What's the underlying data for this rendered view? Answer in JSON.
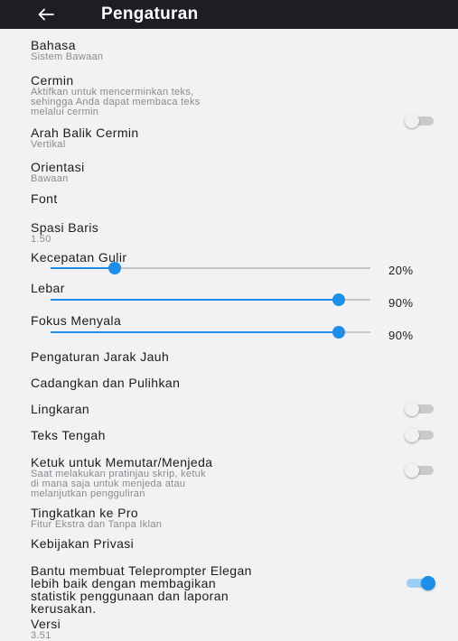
{
  "appbar": {
    "title": "Pengaturan",
    "back_icon": "arrow-left-icon"
  },
  "colors": {
    "appbar_bg": "#1d1d23",
    "accent": "#1e8fe8",
    "background": "#f2f2f4"
  },
  "settings": {
    "language": {
      "title": "Bahasa",
      "value": "Sistem Bawaan"
    },
    "mirror": {
      "title": "Cermin",
      "desc1": "Aktifkan untuk mencerminkan teks,",
      "desc2": "sehingga Anda dapat membaca teks",
      "desc3": "melalui cermin",
      "enabled": false
    },
    "mirror_direction": {
      "title": "Arah Balik Cermin",
      "value": "Vertikal"
    },
    "orientation": {
      "title": "Orientasi",
      "value": "Bawaan"
    },
    "font": {
      "title": "Font"
    },
    "line_spacing": {
      "title": "Spasi Baris",
      "value": "1.50"
    },
    "scroll_speed": {
      "title": "Kecepatan Gulir",
      "percent": 20,
      "label": "20%"
    },
    "width": {
      "title": "Lebar",
      "percent": 90,
      "label": "90%"
    },
    "focus": {
      "title": "Fokus Menyala",
      "percent": 90,
      "label": "90%"
    },
    "remote": {
      "title": "Pengaturan Jarak Jauh"
    },
    "backup": {
      "title": "Cadangkan dan Pulihkan"
    },
    "circle": {
      "title": "Lingkaran",
      "enabled": false
    },
    "center_text": {
      "title": "Teks Tengah",
      "enabled": false
    },
    "tap_to_play": {
      "title": "Ketuk untuk Memutar/Menjeda",
      "desc1": "Saat melakukan pratinjau skrip, ketuk",
      "desc2": "di mana saja untuk menjeda atau",
      "desc3": "melanjutkan pengguliran",
      "enabled": false
    },
    "upgrade": {
      "title": "Tingkatkan ke Pro",
      "desc": "Fitur Ekstra dan Tanpa Iklan"
    },
    "privacy": {
      "title": "Kebijakan Privasi"
    },
    "stats": {
      "line1": "Bantu membuat Teleprompter Elegan",
      "line2": "lebih baik dengan membagikan",
      "line3": "statistik penggunaan dan laporan",
      "line4": "kerusakan.",
      "enabled": true
    },
    "version": {
      "title": "Versi",
      "value": "3.51"
    }
  }
}
